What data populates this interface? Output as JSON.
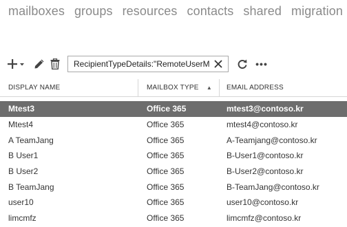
{
  "nav": {
    "tabs": [
      {
        "label": "mailboxes",
        "active": true
      },
      {
        "label": "groups",
        "active": false
      },
      {
        "label": "resources",
        "active": false
      },
      {
        "label": "contacts",
        "active": false
      },
      {
        "label": "shared",
        "active": false
      },
      {
        "label": "migration",
        "active": false
      }
    ]
  },
  "toolbar": {
    "add_icon": "plus-icon",
    "edit_icon": "pencil-icon",
    "delete_icon": "trash-icon",
    "search_value": "RecipientTypeDetails:\"RemoteUserMai",
    "clear_icon": "close-icon",
    "refresh_icon": "refresh-icon",
    "more_label": "•••"
  },
  "table": {
    "columns": {
      "display_name": "DISPLAY NAME",
      "mailbox_type": "MAILBOX TYPE",
      "email_address": "EMAIL ADDRESS",
      "sort_indicator": "▲"
    },
    "rows": [
      {
        "display_name": "Mtest3",
        "mailbox_type": "Office 365",
        "email": "mtest3@contoso.kr",
        "selected": true
      },
      {
        "display_name": "Mtest4",
        "mailbox_type": "Office 365",
        "email": "mtest4@contoso.kr",
        "selected": false
      },
      {
        "display_name": "A TeamJang",
        "mailbox_type": "Office 365",
        "email": "A-Teamjang@contoso.kr",
        "selected": false
      },
      {
        "display_name": "B User1",
        "mailbox_type": "Office 365",
        "email": "B-User1@contoso.kr",
        "selected": false
      },
      {
        "display_name": "B User2",
        "mailbox_type": "Office 365",
        "email": "B-User2@contoso.kr",
        "selected": false
      },
      {
        "display_name": "B TeamJang",
        "mailbox_type": "Office 365",
        "email": "B-TeamJang@contoso.kr",
        "selected": false
      },
      {
        "display_name": "user10",
        "mailbox_type": "Office 365",
        "email": "user10@contoso.kr",
        "selected": false
      },
      {
        "display_name": "limcmfz",
        "mailbox_type": "Office 365",
        "email": "limcmfz@contoso.kr",
        "selected": false
      }
    ]
  },
  "colors": {
    "active_tab": "#1f6fb5",
    "inactive_tab": "#8a8a8a",
    "selected_row_bg": "#6d6d6d",
    "selected_row_text": "#ffffff"
  }
}
